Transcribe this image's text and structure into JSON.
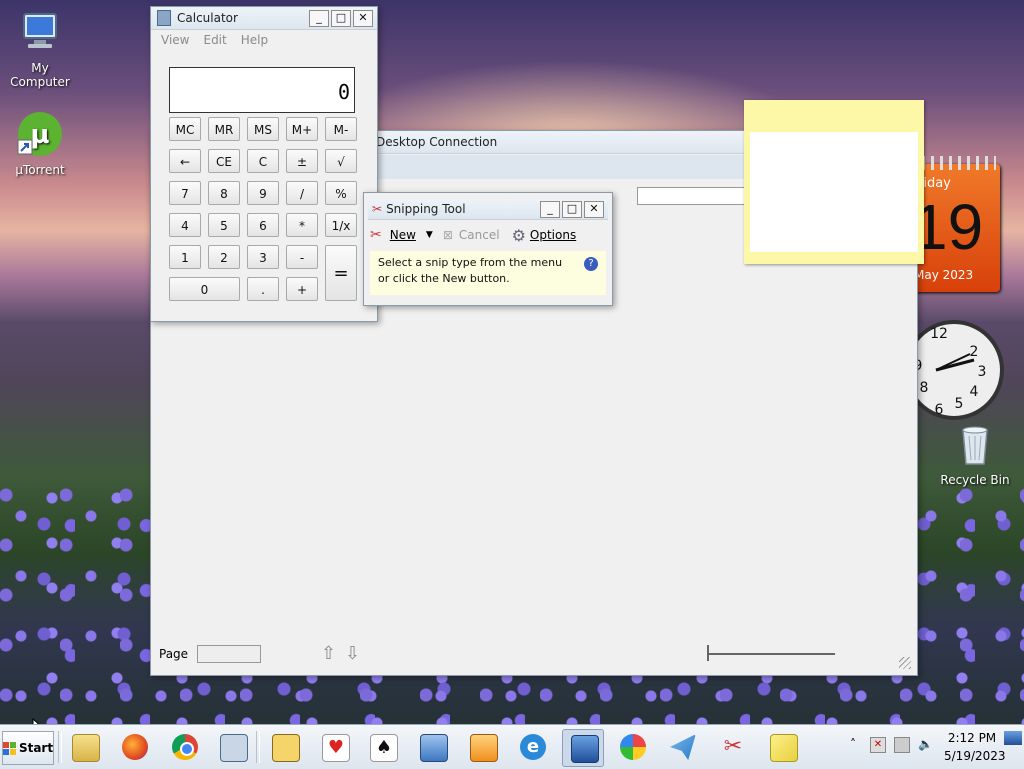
{
  "desktop": {
    "icons": [
      {
        "label": "My Computer",
        "icon": "computer-icon"
      },
      {
        "label": "µTorrent",
        "icon": "utorrent-icon"
      },
      {
        "label": "Recycle Bin",
        "icon": "recycle-bin-icon"
      }
    ],
    "calendar": {
      "day_name": "riday",
      "day_num": "19",
      "month_year": "May 2023"
    },
    "clock_gadget": {
      "numbers": [
        "12",
        "2",
        "3",
        "4",
        "5",
        "6",
        "8",
        "9"
      ]
    }
  },
  "calculator": {
    "title": "Calculator",
    "menu": [
      "View",
      "Edit",
      "Help"
    ],
    "display": "0",
    "keys": [
      [
        "MC",
        "MR",
        "MS",
        "M+",
        "M-"
      ],
      [
        "←",
        "CE",
        "C",
        "±",
        "√"
      ],
      [
        "7",
        "8",
        "9",
        "/",
        "%"
      ],
      [
        "4",
        "5",
        "6",
        "*",
        "1/x"
      ],
      [
        "1",
        "2",
        "3",
        "-"
      ],
      [
        "0",
        ".",
        "+"
      ]
    ],
    "equals": "="
  },
  "remote_desktop": {
    "title": "Desktop Connection",
    "page_label": "Page"
  },
  "snipping": {
    "title": "Snipping Tool",
    "new_label": "New",
    "cancel_label": "Cancel",
    "options_label": "Options",
    "info_line1": "Select a snip type from the menu",
    "info_line2": "or click the New button."
  },
  "taskbar": {
    "start_label": "Start",
    "apps": [
      "file-explorer-icon",
      "firefox-icon",
      "chrome-icon",
      "calculator-icon",
      "solitaire-king-icon",
      "hearts-icon",
      "spider-solitaire-icon",
      "remote-desktop-icon",
      "media-player-icon",
      "internet-explorer-icon",
      "computer-monitor-icon",
      "paint-icon",
      "telegram-icon",
      "snipping-tool-icon",
      "sticky-notes-icon"
    ],
    "time": "2:12 PM",
    "date": "5/19/2023"
  },
  "colors": {
    "accent": "#3a6ea5",
    "sticky_note": "#fdf7a8",
    "calendar_orange": "#e8520f"
  }
}
